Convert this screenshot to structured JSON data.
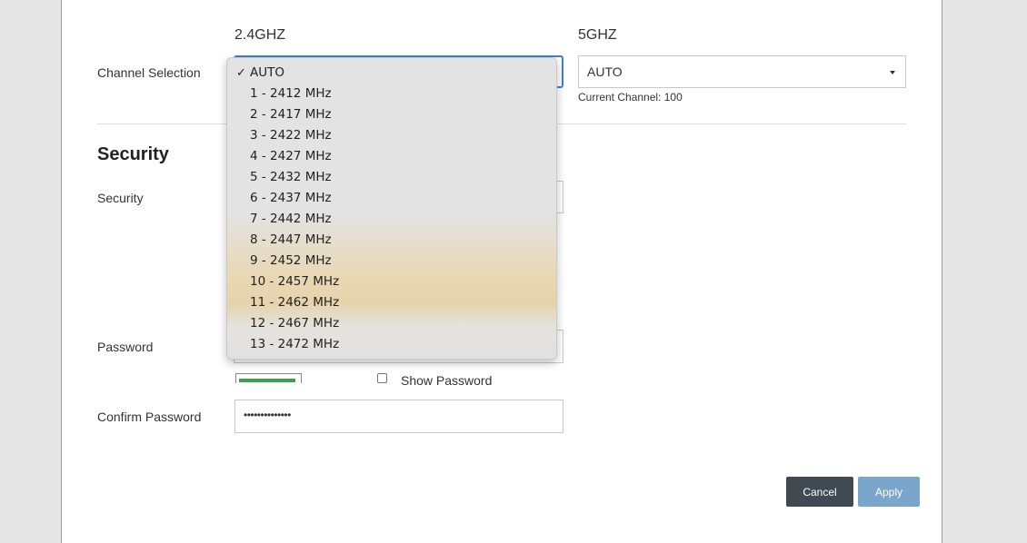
{
  "channel": {
    "row_label": "Channel Selection",
    "band24_label": "2.4GHZ",
    "band5_label": "5GHZ",
    "band5_value": "AUTO",
    "band5_current_channel": "Current Channel: 100",
    "dropdown_options": [
      "AUTO",
      "1 - 2412 MHz",
      "2 - 2417 MHz",
      "3 - 2422 MHz",
      "4 - 2427 MHz",
      "5 - 2432 MHz",
      "6 - 2437 MHz",
      "7 - 2442 MHz",
      "8 - 2447 MHz",
      "9 - 2452 MHz",
      "10 - 2457 MHz",
      "11 - 2462 MHz",
      "12 - 2467 MHz",
      "13 - 2472 MHz"
    ],
    "selected_option": "AUTO",
    "check_mark": "✓"
  },
  "security": {
    "section_title": "Security",
    "security_label": "Security",
    "password_label": "Password",
    "show_password_label": "Show Password",
    "password_strength": 0.95,
    "confirm_label": "Confirm Password",
    "confirm_value": "••••••••••••••"
  },
  "actions": {
    "cancel_label": "Cancel",
    "apply_label": "Apply"
  },
  "colors": {
    "focus_border": "#3d7ed8",
    "cancel_bg": "#3f4a52",
    "apply_bg": "#7aa6cc",
    "strength_fill": "#3fa046"
  }
}
